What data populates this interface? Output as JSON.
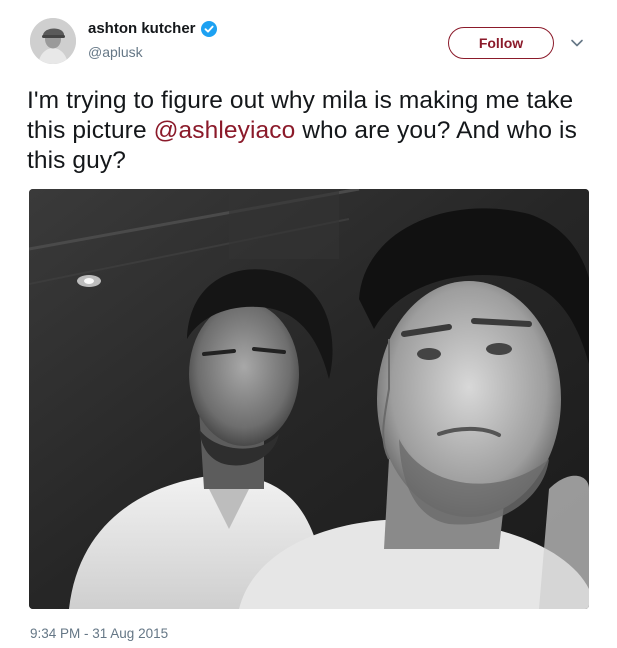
{
  "author": {
    "name": "ashton kutcher",
    "handle": "@aplusk",
    "verified": true,
    "avatar_icon": "avatar-photo"
  },
  "follow_button": {
    "label": "Follow",
    "color": "#8b1a2a"
  },
  "menu": {
    "icon": "chevron-down-icon"
  },
  "tweet": {
    "text_before": "I'm trying to figure out why mila is making me take this picture ",
    "mention": "@ashleyiaco",
    "text_after": " who are you? And who is this guy?",
    "mention_color": "#8b1a2a"
  },
  "media": {
    "type": "black-and-white photo of two men"
  },
  "timestamp": "9:34 PM - 31 Aug 2015",
  "colors": {
    "text": "#14171a",
    "secondary": "#657786",
    "verified_badge": "#1da1f2"
  }
}
